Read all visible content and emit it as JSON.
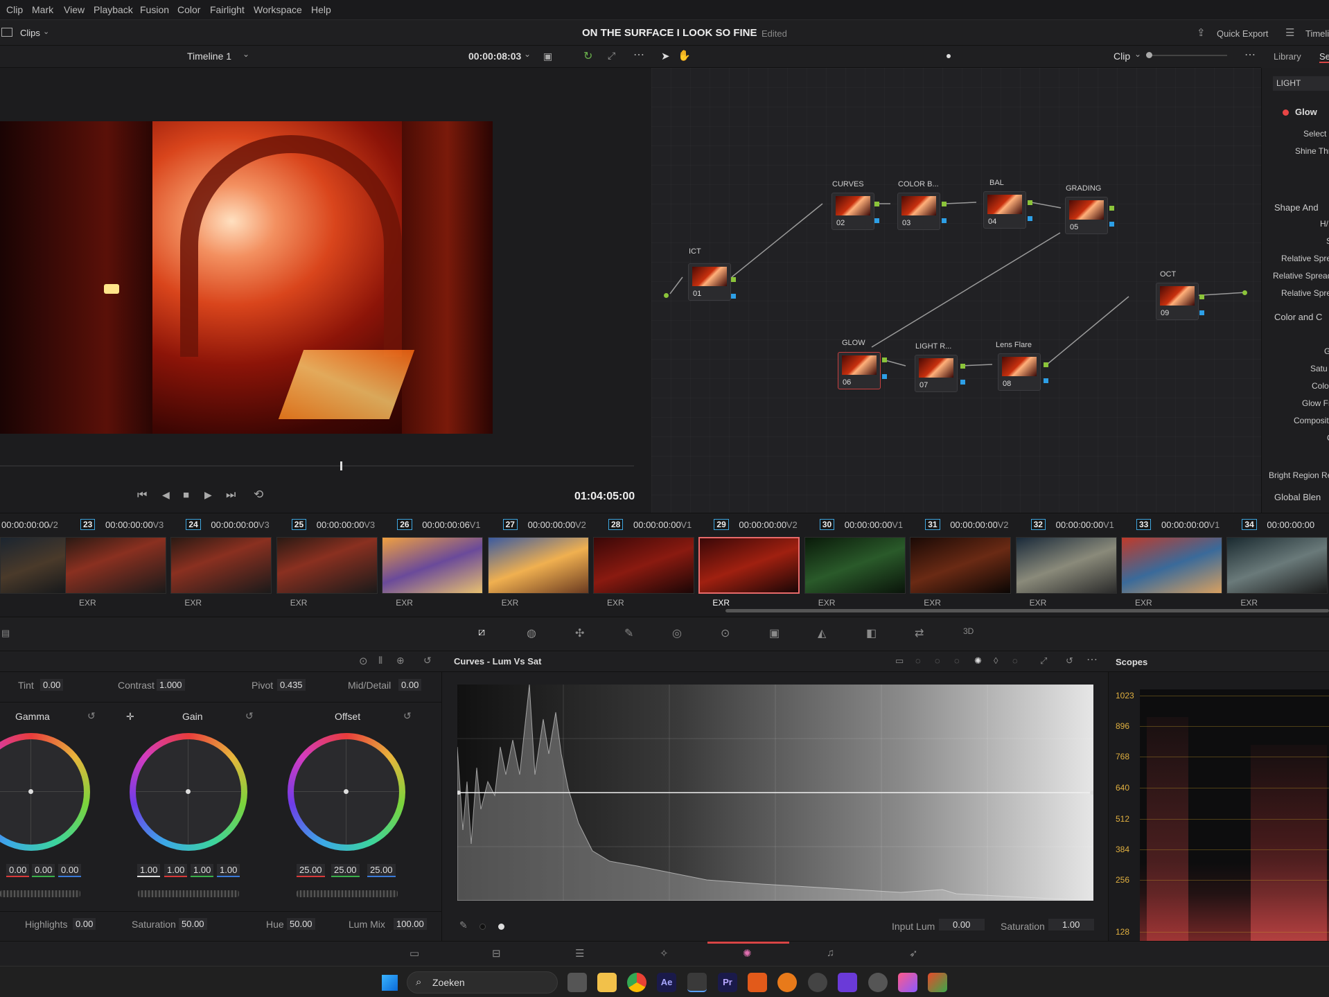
{
  "menu": [
    "Clip",
    "Mark",
    "View",
    "Playback",
    "Fusion",
    "Color",
    "Fairlight",
    "Workspace",
    "Help"
  ],
  "titlebar": {
    "clips_label": "Clips",
    "project_title": "ON THE SURFACE I LOOK SO FINE",
    "status": "Edited",
    "quick_export": "Quick Export",
    "timeline_tab": "Timeli"
  },
  "viewer": {
    "timeline_name": "Timeline 1",
    "timecode": "00:00:08:03",
    "playhead_tc": "01:04:05:00"
  },
  "nodegraph": {
    "mode": "Clip",
    "nodes": [
      {
        "label": "ICT",
        "num": "01"
      },
      {
        "label": "CURVES",
        "num": "02"
      },
      {
        "label": "COLOR B...",
        "num": "03"
      },
      {
        "label": "BAL",
        "num": "04"
      },
      {
        "label": "GRADING",
        "num": "05"
      },
      {
        "label": "GLOW",
        "num": "06"
      },
      {
        "label": "LIGHT R...",
        "num": "07"
      },
      {
        "label": "Lens Flare",
        "num": "08"
      },
      {
        "label": "OCT",
        "num": "09"
      }
    ]
  },
  "rightpanel": {
    "tab_library": "Library",
    "tab_se": "Se",
    "search": "LIGHT",
    "fx_name": "Glow",
    "items": [
      "Select C",
      "Shine Thre",
      "Shape And",
      "H/",
      "S",
      "Relative Sprea",
      "Relative Spread",
      "Relative Sprea",
      "Color and C",
      "G",
      "Satu",
      "Colo",
      "Glow Fr",
      "Composit",
      "C",
      "Bright Region Re",
      "Global Blen"
    ]
  },
  "clips": [
    {
      "tc": "00:00:00:00",
      "track": "V2",
      "num": "23",
      "type": "EXR"
    },
    {
      "tc": "00:00:00:00",
      "track": "V3",
      "num": "24",
      "type": "EXR"
    },
    {
      "tc": "00:00:00:00",
      "track": "V3",
      "num": "25",
      "type": "EXR"
    },
    {
      "tc": "00:00:00:06",
      "track": "V3",
      "num": "26",
      "type": "EXR"
    },
    {
      "tc": "00:00:00:00",
      "track": "V1",
      "num": "27",
      "type": "EXR"
    },
    {
      "tc": "00:00:00:00",
      "track": "V2",
      "num": "28",
      "type": "EXR"
    },
    {
      "tc": "00:00:00:00",
      "track": "V1",
      "num": "29",
      "type": "EXR"
    },
    {
      "tc": "00:00:00:00",
      "track": "V2",
      "num": "30",
      "type": "EXR"
    },
    {
      "tc": "00:00:00:00",
      "track": "V1",
      "num": "31",
      "type": "EXR"
    },
    {
      "tc": "00:00:00:00",
      "track": "V2",
      "num": "32",
      "type": "EXR"
    },
    {
      "tc": "00:00:00:00",
      "track": "V1",
      "num": "33",
      "type": "EXR"
    },
    {
      "tc": "00:00:00:00",
      "track": "V1",
      "num": "34",
      "type": "EXR"
    }
  ],
  "wheels": {
    "tint_label": "Tint",
    "tint": "0.00",
    "contrast_label": "Contrast",
    "contrast": "1.000",
    "pivot_label": "Pivot",
    "pivot": "0.435",
    "middetail_label": "Mid/Detail",
    "middetail": "0.00",
    "gamma_label": "Gamma",
    "gain_label": "Gain",
    "offset_label": "Offset",
    "gamma_vals": [
      "0.00",
      "0.00",
      "0.00"
    ],
    "gain_vals": [
      "1.00",
      "1.00",
      "1.00",
      "1.00"
    ],
    "offset_vals": [
      "25.00",
      "25.00",
      "25.00"
    ],
    "highlights_label": "Highlights",
    "highlights": "0.00",
    "saturation_label": "Saturation",
    "saturation": "50.00",
    "hue_label": "Hue",
    "hue": "50.00",
    "lummix_label": "Lum Mix",
    "lummix": "100.00"
  },
  "curves": {
    "title": "Curves - Lum Vs Sat",
    "input_lum_label": "Input Lum",
    "input_lum": "0.00",
    "saturation_label": "Saturation",
    "saturation": "1.00"
  },
  "scopes": {
    "title": "Scopes",
    "levels": [
      "1023",
      "896",
      "768",
      "640",
      "512",
      "384",
      "256",
      "128"
    ]
  },
  "taskbar": {
    "search": "Zoeken"
  }
}
